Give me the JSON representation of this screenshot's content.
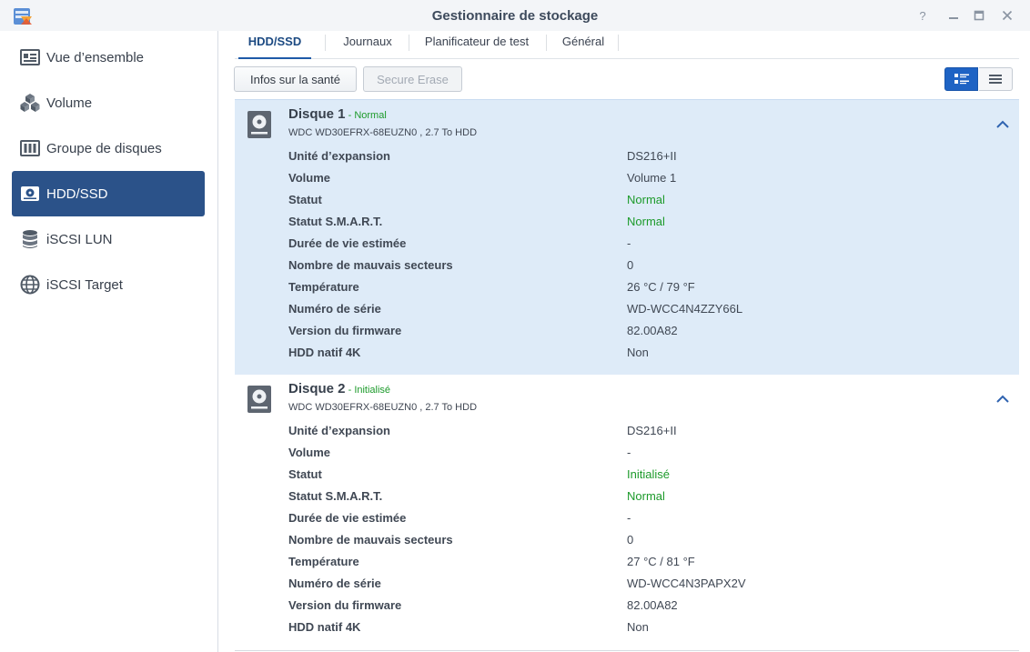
{
  "window": {
    "title": "Gestionnaire de stockage",
    "help_glyph": "?"
  },
  "sidebar": {
    "items": [
      {
        "label": "Vue d’ensemble",
        "icon": "overview-icon",
        "active": false
      },
      {
        "label": "Volume",
        "icon": "volume-cubes-icon",
        "active": false
      },
      {
        "label": "Groupe de disques",
        "icon": "disk-group-icon",
        "active": false
      },
      {
        "label": "HDD/SSD",
        "icon": "hdd-icon",
        "active": true
      },
      {
        "label": "iSCSI LUN",
        "icon": "database-icon",
        "active": false
      },
      {
        "label": "iSCSI Target",
        "icon": "globe-icon",
        "active": false
      }
    ]
  },
  "tabs": [
    {
      "label": "HDD/SSD",
      "active": true
    },
    {
      "label": "Journaux",
      "active": false
    },
    {
      "label": "Planificateur de test",
      "active": false
    },
    {
      "label": "Général",
      "active": false
    }
  ],
  "toolbar": {
    "health_label": "Infos sur la santé",
    "erase_label": "Secure Erase"
  },
  "disks": [
    {
      "name": "Disque 1",
      "dash": " - ",
      "status": "Normal",
      "model": "WDC WD30EFRX-68EUZN0 , 2.7 To HDD",
      "rows": [
        {
          "key": "Unité d’expansion",
          "value": "DS216+II"
        },
        {
          "key": "Volume",
          "value": "Volume 1"
        },
        {
          "key": "Statut",
          "value": "Normal"
        },
        {
          "key": "Statut S.M.A.R.T.",
          "value": "Normal"
        },
        {
          "key": "Durée de vie estimée",
          "value": "-"
        },
        {
          "key": "Nombre de mauvais secteurs",
          "value": "0"
        },
        {
          "key": "Température",
          "value": "26 °C / 79 °F"
        },
        {
          "key": "Numéro de série",
          "value": "WD-WCC4N4ZZY66L"
        },
        {
          "key": "Version du firmware",
          "value": "82.00A82"
        },
        {
          "key": "HDD natif 4K",
          "value": "Non"
        }
      ]
    },
    {
      "name": "Disque 2",
      "dash": " - ",
      "status": "Initialisé",
      "model": "WDC WD30EFRX-68EUZN0 , 2.7 To HDD",
      "rows": [
        {
          "key": "Unité d’expansion",
          "value": "DS216+II"
        },
        {
          "key": "Volume",
          "value": "-"
        },
        {
          "key": "Statut",
          "value": "Initialisé"
        },
        {
          "key": "Statut S.M.A.R.T.",
          "value": "Normal"
        },
        {
          "key": "Durée de vie estimée",
          "value": "-"
        },
        {
          "key": "Nombre de mauvais secteurs",
          "value": "0"
        },
        {
          "key": "Température",
          "value": "27 °C / 81 °F"
        },
        {
          "key": "Numéro de série",
          "value": "WD-WCC4N3PAPX2V"
        },
        {
          "key": "Version du firmware",
          "value": "82.00A82"
        },
        {
          "key": "HDD natif 4K",
          "value": "Non"
        }
      ]
    }
  ],
  "colors": {
    "accent": "#2b5289",
    "status_green": "#1c9a2a",
    "highlight_row": "#deebf8"
  }
}
